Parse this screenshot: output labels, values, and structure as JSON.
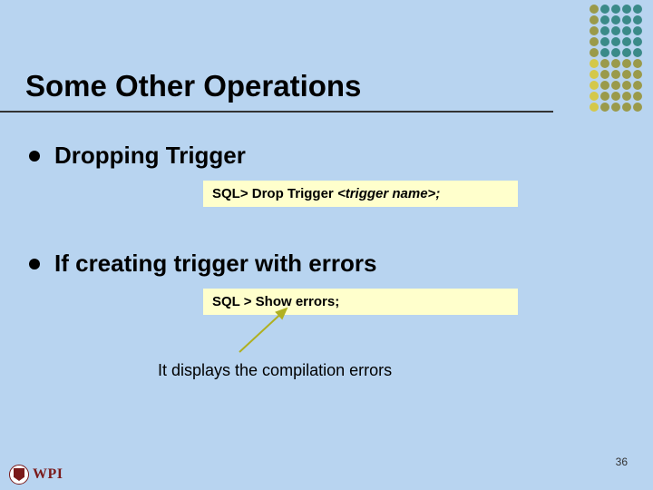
{
  "title": "Some Other Operations",
  "bullets": [
    {
      "text": "Dropping Trigger"
    },
    {
      "text": "If creating trigger with errors"
    }
  ],
  "code_boxes": [
    {
      "prefix": "SQL> Drop Trigger ",
      "arg": "<trigger name>;"
    },
    {
      "prefix": "SQL > Show errors",
      "arg": ";"
    }
  ],
  "note": "It displays the compilation errors",
  "page_number": "36",
  "logo_text": "WPI"
}
